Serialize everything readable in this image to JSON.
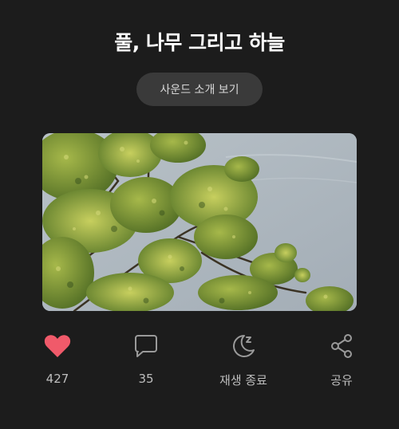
{
  "title": "풀, 나무 그리고 하늘",
  "sound_intro_button": "사운드 소개 보기",
  "actions": {
    "like": {
      "label": "427",
      "icon": "heart-icon",
      "color": "#f05a6a"
    },
    "comment": {
      "label": "35",
      "icon": "speech-bubble-icon"
    },
    "sleep_timer": {
      "label": "재생 종료",
      "icon": "moon-zz-icon"
    },
    "share": {
      "label": "공유",
      "icon": "share-icon"
    }
  },
  "colors": {
    "background": "#1c1c1c",
    "pill": "#3a3a3a",
    "icon": "#9a9a9a",
    "label": "#bdbdbd"
  }
}
